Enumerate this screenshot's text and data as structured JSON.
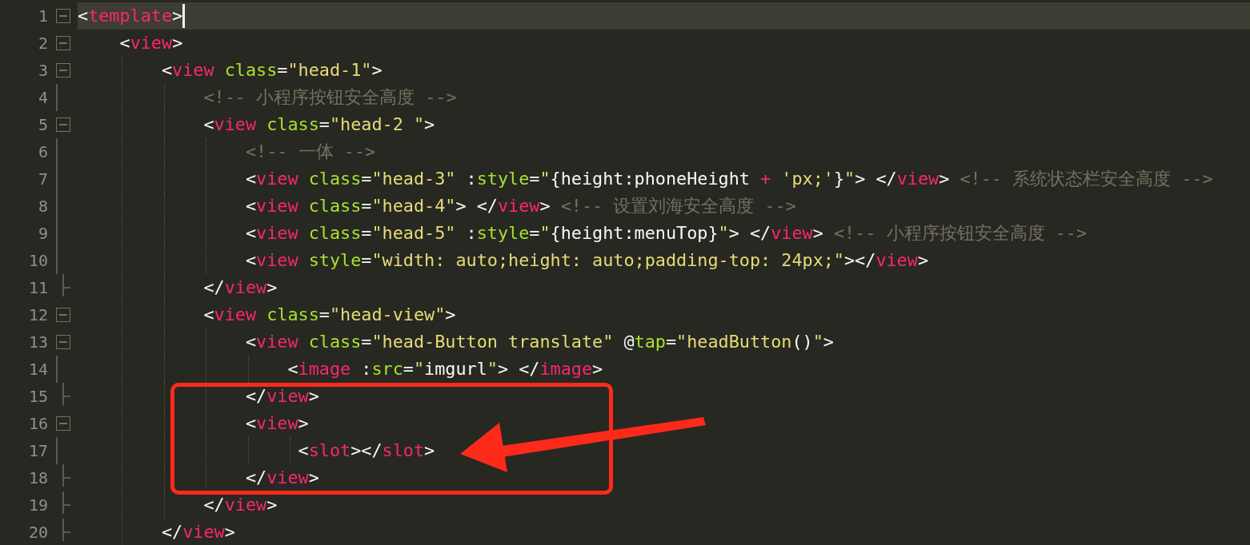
{
  "editor": {
    "lines": [
      {
        "number": "1",
        "fold": {
          "kind": "start"
        },
        "current": true,
        "tokens": [
          {
            "kind": "punct",
            "text": "<"
          },
          {
            "kind": "tag",
            "text": "template"
          },
          {
            "kind": "punct",
            "text": ">"
          }
        ]
      },
      {
        "number": "2",
        "fold": {
          "kind": "start"
        },
        "current": false,
        "tokens": [
          {
            "kind": "punct",
            "text": "    <"
          },
          {
            "kind": "tag",
            "text": "view"
          },
          {
            "kind": "punct",
            "text": ">"
          }
        ]
      },
      {
        "number": "3",
        "fold": {
          "kind": "start"
        },
        "current": false,
        "tokens": [
          {
            "kind": "punct",
            "text": "        <"
          },
          {
            "kind": "tag",
            "text": "view"
          },
          {
            "kind": "attr",
            "text": " class"
          },
          {
            "kind": "punct",
            "text": "="
          },
          {
            "kind": "string",
            "text": "\"head-1\""
          },
          {
            "kind": "punct",
            "text": ">"
          }
        ]
      },
      {
        "number": "4",
        "fold": {
          "kind": "inside"
        },
        "current": false,
        "tokens": [
          {
            "kind": "comment",
            "text": "            <!-- 小程序按钮安全高度 -->"
          }
        ]
      },
      {
        "number": "5",
        "fold": {
          "kind": "start"
        },
        "current": false,
        "tokens": [
          {
            "kind": "punct",
            "text": "            <"
          },
          {
            "kind": "tag",
            "text": "view"
          },
          {
            "kind": "attr",
            "text": " class"
          },
          {
            "kind": "punct",
            "text": "="
          },
          {
            "kind": "string",
            "text": "\"head-2 \""
          },
          {
            "kind": "punct",
            "text": ">"
          }
        ]
      },
      {
        "number": "6",
        "fold": {
          "kind": "inside"
        },
        "current": false,
        "tokens": [
          {
            "kind": "comment",
            "text": "                <!-- 一体 -->"
          }
        ]
      },
      {
        "number": "7",
        "fold": {
          "kind": "inside"
        },
        "current": false,
        "tokens": [
          {
            "kind": "punct",
            "text": "                <"
          },
          {
            "kind": "tag",
            "text": "view"
          },
          {
            "kind": "attr",
            "text": " class"
          },
          {
            "kind": "punct",
            "text": "="
          },
          {
            "kind": "string",
            "text": "\"head-3\""
          },
          {
            "kind": "punct",
            "text": " :"
          },
          {
            "kind": "attr",
            "text": "style"
          },
          {
            "kind": "punct",
            "text": "="
          },
          {
            "kind": "string",
            "text": "\""
          },
          {
            "kind": "punct",
            "text": "{height:phoneHeight "
          },
          {
            "kind": "operator",
            "text": "+"
          },
          {
            "kind": "string",
            "text": " 'px;'"
          },
          {
            "kind": "punct",
            "text": "}"
          },
          {
            "kind": "string",
            "text": "\""
          },
          {
            "kind": "punct",
            "text": "> </"
          },
          {
            "kind": "tag",
            "text": "view"
          },
          {
            "kind": "punct",
            "text": ">"
          },
          {
            "kind": "comment",
            "text": " <!-- 系统状态栏安全高度 -->"
          }
        ]
      },
      {
        "number": "8",
        "fold": {
          "kind": "inside"
        },
        "current": false,
        "tokens": [
          {
            "kind": "punct",
            "text": "                <"
          },
          {
            "kind": "tag",
            "text": "view"
          },
          {
            "kind": "attr",
            "text": " class"
          },
          {
            "kind": "punct",
            "text": "="
          },
          {
            "kind": "string",
            "text": "\"head-4\""
          },
          {
            "kind": "punct",
            "text": "> </"
          },
          {
            "kind": "tag",
            "text": "view"
          },
          {
            "kind": "punct",
            "text": ">"
          },
          {
            "kind": "comment",
            "text": " <!-- 设置刘海安全高度 -->"
          }
        ]
      },
      {
        "number": "9",
        "fold": {
          "kind": "inside"
        },
        "current": false,
        "tokens": [
          {
            "kind": "punct",
            "text": "                <"
          },
          {
            "kind": "tag",
            "text": "view"
          },
          {
            "kind": "attr",
            "text": " class"
          },
          {
            "kind": "punct",
            "text": "="
          },
          {
            "kind": "string",
            "text": "\"head-5\""
          },
          {
            "kind": "punct",
            "text": " :"
          },
          {
            "kind": "attr",
            "text": "style"
          },
          {
            "kind": "punct",
            "text": "="
          },
          {
            "kind": "string",
            "text": "\""
          },
          {
            "kind": "punct",
            "text": "{height:menuTop}"
          },
          {
            "kind": "string",
            "text": "\""
          },
          {
            "kind": "punct",
            "text": "> </"
          },
          {
            "kind": "tag",
            "text": "view"
          },
          {
            "kind": "punct",
            "text": ">"
          },
          {
            "kind": "comment",
            "text": " <!-- 小程序按钮安全高度 -->"
          }
        ]
      },
      {
        "number": "10",
        "fold": {
          "kind": "inside"
        },
        "current": false,
        "tokens": [
          {
            "kind": "punct",
            "text": "                <"
          },
          {
            "kind": "tag",
            "text": "view"
          },
          {
            "kind": "attr",
            "text": " style"
          },
          {
            "kind": "punct",
            "text": "="
          },
          {
            "kind": "string",
            "text": "\"width: auto;height: auto;padding-top: 24px;\""
          },
          {
            "kind": "punct",
            "text": "></"
          },
          {
            "kind": "tag",
            "text": "view"
          },
          {
            "kind": "punct",
            "text": ">"
          }
        ]
      },
      {
        "number": "11",
        "fold": {
          "kind": "end"
        },
        "current": false,
        "tokens": [
          {
            "kind": "punct",
            "text": "            </"
          },
          {
            "kind": "tag",
            "text": "view"
          },
          {
            "kind": "punct",
            "text": ">"
          }
        ]
      },
      {
        "number": "12",
        "fold": {
          "kind": "start"
        },
        "current": false,
        "tokens": [
          {
            "kind": "punct",
            "text": "            <"
          },
          {
            "kind": "tag",
            "text": "view"
          },
          {
            "kind": "attr",
            "text": " class"
          },
          {
            "kind": "punct",
            "text": "="
          },
          {
            "kind": "string",
            "text": "\"head-view\""
          },
          {
            "kind": "punct",
            "text": ">"
          }
        ]
      },
      {
        "number": "13",
        "fold": {
          "kind": "start"
        },
        "current": false,
        "tokens": [
          {
            "kind": "punct",
            "text": "                <"
          },
          {
            "kind": "tag",
            "text": "view"
          },
          {
            "kind": "attr",
            "text": " class"
          },
          {
            "kind": "punct",
            "text": "="
          },
          {
            "kind": "string",
            "text": "\"head-Button translate\""
          },
          {
            "kind": "punct",
            "text": " @"
          },
          {
            "kind": "attr",
            "text": "tap"
          },
          {
            "kind": "punct",
            "text": "="
          },
          {
            "kind": "string",
            "text": "\"headButton"
          },
          {
            "kind": "punct",
            "text": "()"
          },
          {
            "kind": "string",
            "text": "\""
          },
          {
            "kind": "punct",
            "text": ">"
          }
        ]
      },
      {
        "number": "14",
        "fold": {
          "kind": "inside"
        },
        "current": false,
        "tokens": [
          {
            "kind": "punct",
            "text": "                    <"
          },
          {
            "kind": "tag",
            "text": "image"
          },
          {
            "kind": "punct",
            "text": " :"
          },
          {
            "kind": "attr",
            "text": "src"
          },
          {
            "kind": "punct",
            "text": "="
          },
          {
            "kind": "string",
            "text": "\""
          },
          {
            "kind": "punct",
            "text": "imgurl"
          },
          {
            "kind": "string",
            "text": "\""
          },
          {
            "kind": "punct",
            "text": "> </"
          },
          {
            "kind": "tag",
            "text": "image"
          },
          {
            "kind": "punct",
            "text": ">"
          }
        ]
      },
      {
        "number": "15",
        "fold": {
          "kind": "end"
        },
        "current": false,
        "tokens": [
          {
            "kind": "punct",
            "text": "                </"
          },
          {
            "kind": "tag",
            "text": "view"
          },
          {
            "kind": "punct",
            "text": ">"
          }
        ]
      },
      {
        "number": "16",
        "fold": {
          "kind": "start"
        },
        "current": false,
        "tokens": [
          {
            "kind": "punct",
            "text": "                <"
          },
          {
            "kind": "tag",
            "text": "view"
          },
          {
            "kind": "punct",
            "text": ">"
          }
        ]
      },
      {
        "number": "17",
        "fold": {
          "kind": "inside"
        },
        "current": false,
        "tokens": [
          {
            "kind": "punct",
            "text": "                     <"
          },
          {
            "kind": "tag",
            "text": "slot"
          },
          {
            "kind": "punct",
            "text": "></"
          },
          {
            "kind": "tag",
            "text": "slot"
          },
          {
            "kind": "punct",
            "text": ">"
          }
        ]
      },
      {
        "number": "18",
        "fold": {
          "kind": "end"
        },
        "current": false,
        "tokens": [
          {
            "kind": "punct",
            "text": "                </"
          },
          {
            "kind": "tag",
            "text": "view"
          },
          {
            "kind": "punct",
            "text": ">"
          }
        ]
      },
      {
        "number": "19",
        "fold": {
          "kind": "end"
        },
        "current": false,
        "tokens": [
          {
            "kind": "punct",
            "text": "            </"
          },
          {
            "kind": "tag",
            "text": "view"
          },
          {
            "kind": "punct",
            "text": ">"
          }
        ]
      },
      {
        "number": "20",
        "fold": {
          "kind": "end"
        },
        "current": false,
        "tokens": [
          {
            "kind": "punct",
            "text": "        </"
          },
          {
            "kind": "tag",
            "text": "view"
          },
          {
            "kind": "punct",
            "text": ">"
          }
        ]
      }
    ]
  }
}
